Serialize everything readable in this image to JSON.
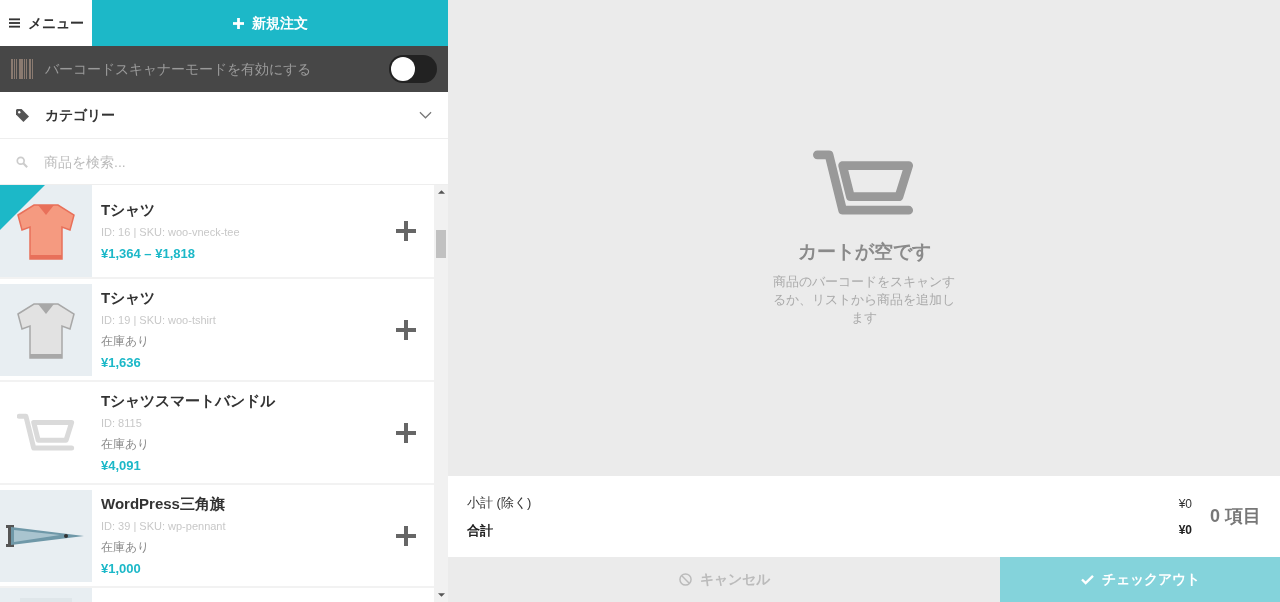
{
  "header": {
    "menu_label": "メニュー",
    "new_order_label": "新規注文"
  },
  "scanner": {
    "label": "バーコードスキャナーモードを有効にする",
    "on": false
  },
  "category": {
    "label": "カテゴリー",
    "expanded": false
  },
  "search": {
    "placeholder": "商品を検索..."
  },
  "products": [
    {
      "name": "Tシャツ",
      "meta": "ID: 16 | SKU: woo-vneck-tee",
      "price": "¥1,364 – ¥1,818",
      "on_sale": true,
      "kind": "picture"
    },
    {
      "name": "Tシャツ",
      "meta": "ID: 19 | SKU: woo-tshirt",
      "stock": "在庫あり",
      "price": "¥1,636",
      "on_sale": false,
      "kind": "picture"
    },
    {
      "name": "Tシャツスマートバンドル",
      "meta": "ID: 8115",
      "stock": "在庫あり",
      "price": "¥4,091",
      "on_sale": false,
      "kind": "placeholder"
    },
    {
      "name": "WordPress三角旗",
      "meta": "ID: 39 | SKU: wp-pennant",
      "stock": "在庫あり",
      "price": "¥1,000",
      "on_sale": false,
      "kind": "picture"
    }
  ],
  "cart": {
    "empty_title": "カートが空です",
    "empty_message": "商品のバーコードをスキャンするか、リストから商品を追加します"
  },
  "totals": {
    "subtotal_label": "小計 (除く)",
    "subtotal_value": "¥0",
    "total_label": "合計",
    "total_value": "¥0",
    "items_count": "0 項目"
  },
  "actions": {
    "cancel_label": "キャンセル",
    "checkout_label": "チェックアウト"
  }
}
